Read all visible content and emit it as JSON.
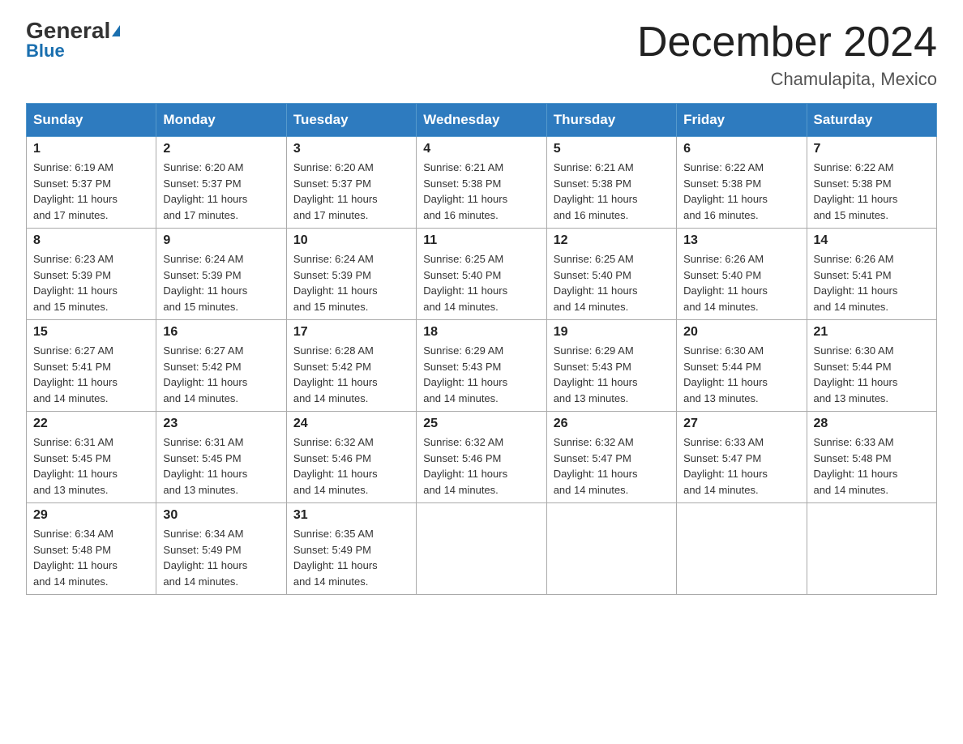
{
  "logo": {
    "general": "General",
    "blue": "Blue"
  },
  "title": "December 2024",
  "location": "Chamulapita, Mexico",
  "headers": [
    "Sunday",
    "Monday",
    "Tuesday",
    "Wednesday",
    "Thursday",
    "Friday",
    "Saturday"
  ],
  "weeks": [
    [
      {
        "day": "1",
        "sunrise": "6:19 AM",
        "sunset": "5:37 PM",
        "daylight": "11 hours and 17 minutes."
      },
      {
        "day": "2",
        "sunrise": "6:20 AM",
        "sunset": "5:37 PM",
        "daylight": "11 hours and 17 minutes."
      },
      {
        "day": "3",
        "sunrise": "6:20 AM",
        "sunset": "5:37 PM",
        "daylight": "11 hours and 17 minutes."
      },
      {
        "day": "4",
        "sunrise": "6:21 AM",
        "sunset": "5:38 PM",
        "daylight": "11 hours and 16 minutes."
      },
      {
        "day": "5",
        "sunrise": "6:21 AM",
        "sunset": "5:38 PM",
        "daylight": "11 hours and 16 minutes."
      },
      {
        "day": "6",
        "sunrise": "6:22 AM",
        "sunset": "5:38 PM",
        "daylight": "11 hours and 16 minutes."
      },
      {
        "day": "7",
        "sunrise": "6:22 AM",
        "sunset": "5:38 PM",
        "daylight": "11 hours and 15 minutes."
      }
    ],
    [
      {
        "day": "8",
        "sunrise": "6:23 AM",
        "sunset": "5:39 PM",
        "daylight": "11 hours and 15 minutes."
      },
      {
        "day": "9",
        "sunrise": "6:24 AM",
        "sunset": "5:39 PM",
        "daylight": "11 hours and 15 minutes."
      },
      {
        "day": "10",
        "sunrise": "6:24 AM",
        "sunset": "5:39 PM",
        "daylight": "11 hours and 15 minutes."
      },
      {
        "day": "11",
        "sunrise": "6:25 AM",
        "sunset": "5:40 PM",
        "daylight": "11 hours and 14 minutes."
      },
      {
        "day": "12",
        "sunrise": "6:25 AM",
        "sunset": "5:40 PM",
        "daylight": "11 hours and 14 minutes."
      },
      {
        "day": "13",
        "sunrise": "6:26 AM",
        "sunset": "5:40 PM",
        "daylight": "11 hours and 14 minutes."
      },
      {
        "day": "14",
        "sunrise": "6:26 AM",
        "sunset": "5:41 PM",
        "daylight": "11 hours and 14 minutes."
      }
    ],
    [
      {
        "day": "15",
        "sunrise": "6:27 AM",
        "sunset": "5:41 PM",
        "daylight": "11 hours and 14 minutes."
      },
      {
        "day": "16",
        "sunrise": "6:27 AM",
        "sunset": "5:42 PM",
        "daylight": "11 hours and 14 minutes."
      },
      {
        "day": "17",
        "sunrise": "6:28 AM",
        "sunset": "5:42 PM",
        "daylight": "11 hours and 14 minutes."
      },
      {
        "day": "18",
        "sunrise": "6:29 AM",
        "sunset": "5:43 PM",
        "daylight": "11 hours and 14 minutes."
      },
      {
        "day": "19",
        "sunrise": "6:29 AM",
        "sunset": "5:43 PM",
        "daylight": "11 hours and 13 minutes."
      },
      {
        "day": "20",
        "sunrise": "6:30 AM",
        "sunset": "5:44 PM",
        "daylight": "11 hours and 13 minutes."
      },
      {
        "day": "21",
        "sunrise": "6:30 AM",
        "sunset": "5:44 PM",
        "daylight": "11 hours and 13 minutes."
      }
    ],
    [
      {
        "day": "22",
        "sunrise": "6:31 AM",
        "sunset": "5:45 PM",
        "daylight": "11 hours and 13 minutes."
      },
      {
        "day": "23",
        "sunrise": "6:31 AM",
        "sunset": "5:45 PM",
        "daylight": "11 hours and 13 minutes."
      },
      {
        "day": "24",
        "sunrise": "6:32 AM",
        "sunset": "5:46 PM",
        "daylight": "11 hours and 14 minutes."
      },
      {
        "day": "25",
        "sunrise": "6:32 AM",
        "sunset": "5:46 PM",
        "daylight": "11 hours and 14 minutes."
      },
      {
        "day": "26",
        "sunrise": "6:32 AM",
        "sunset": "5:47 PM",
        "daylight": "11 hours and 14 minutes."
      },
      {
        "day": "27",
        "sunrise": "6:33 AM",
        "sunset": "5:47 PM",
        "daylight": "11 hours and 14 minutes."
      },
      {
        "day": "28",
        "sunrise": "6:33 AM",
        "sunset": "5:48 PM",
        "daylight": "11 hours and 14 minutes."
      }
    ],
    [
      {
        "day": "29",
        "sunrise": "6:34 AM",
        "sunset": "5:48 PM",
        "daylight": "11 hours and 14 minutes."
      },
      {
        "day": "30",
        "sunrise": "6:34 AM",
        "sunset": "5:49 PM",
        "daylight": "11 hours and 14 minutes."
      },
      {
        "day": "31",
        "sunrise": "6:35 AM",
        "sunset": "5:49 PM",
        "daylight": "11 hours and 14 minutes."
      },
      null,
      null,
      null,
      null
    ]
  ]
}
